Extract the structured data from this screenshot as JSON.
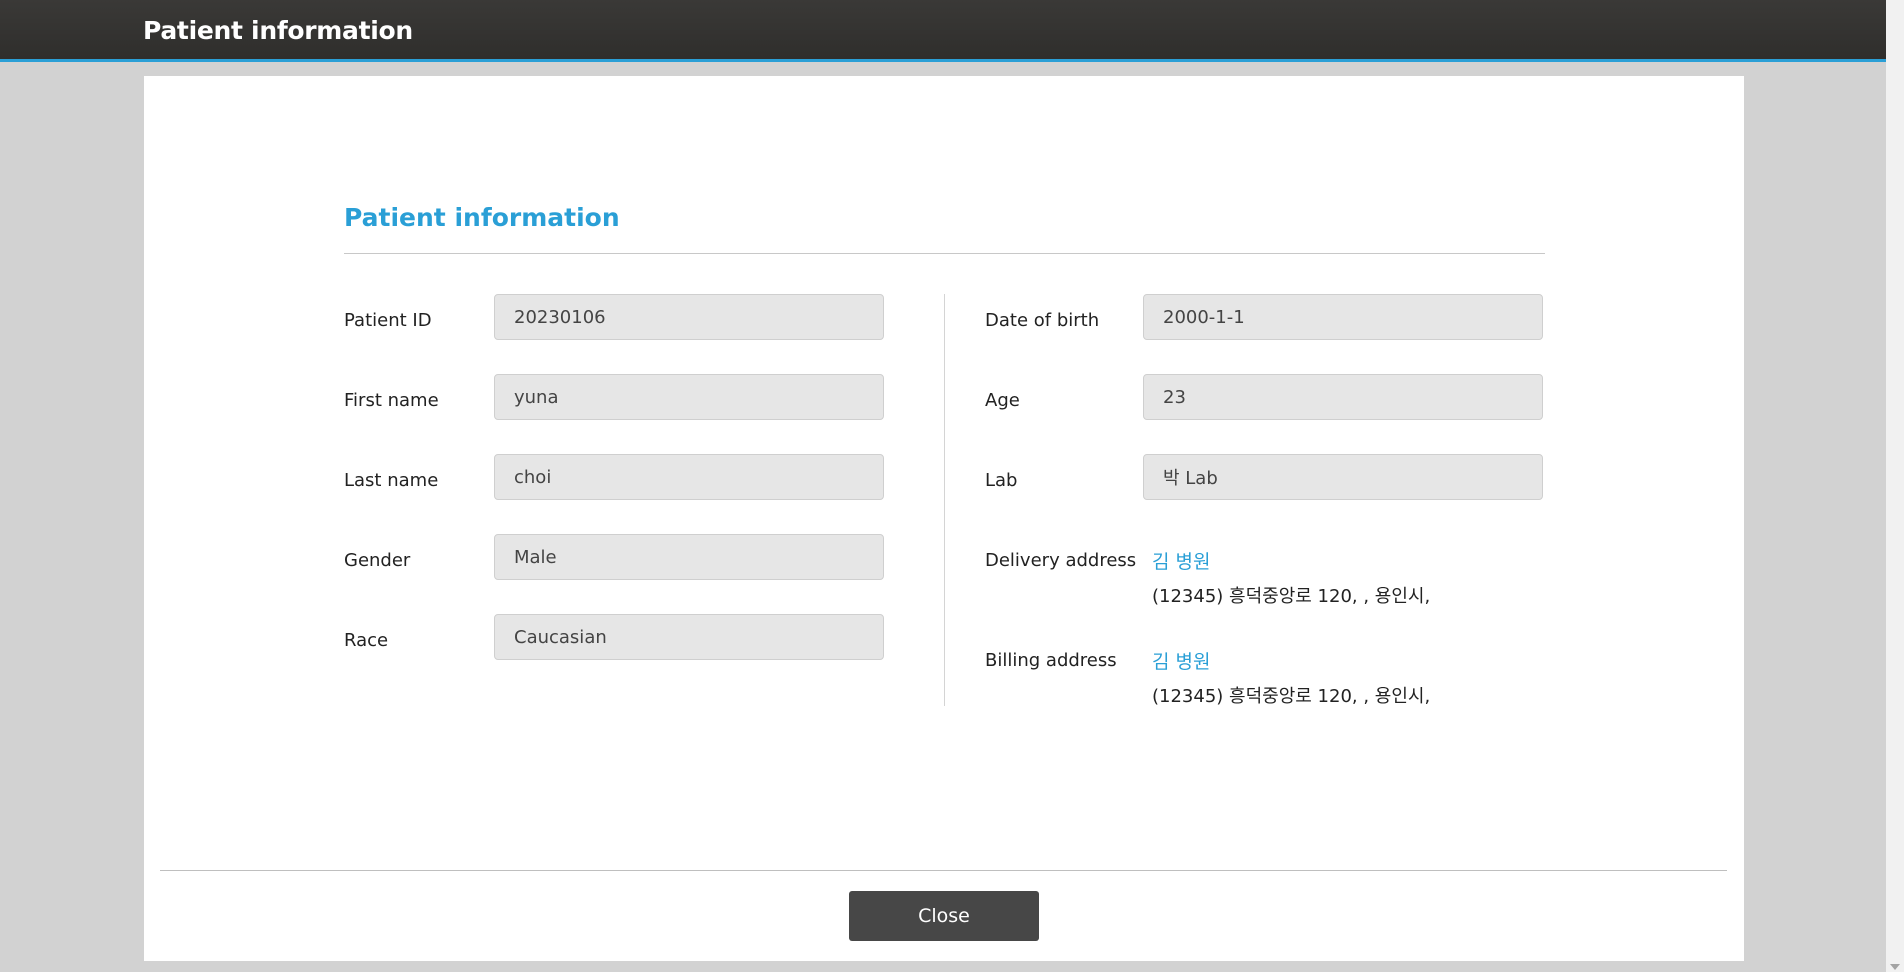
{
  "window": {
    "title": "Patient information"
  },
  "section": {
    "title": "Patient information"
  },
  "left_fields": [
    {
      "label": "Patient ID",
      "value": "20230106"
    },
    {
      "label": "First name",
      "value": "yuna"
    },
    {
      "label": "Last name",
      "value": "choi"
    },
    {
      "label": "Gender",
      "value": "Male"
    },
    {
      "label": "Race",
      "value": "Caucasian"
    }
  ],
  "right_fields": [
    {
      "label": "Date of birth",
      "value": "2000-1-1"
    },
    {
      "label": "Age",
      "value": "23"
    },
    {
      "label": "Lab",
      "value": "박 Lab"
    }
  ],
  "delivery_address": {
    "label": "Delivery address",
    "name": "김 병원",
    "line": "(12345) 흥덕중앙로 120, , 용인시,"
  },
  "billing_address": {
    "label": "Billing address",
    "name": "김 병원",
    "line": "(12345) 흥덕중앙로 120, , 용인시,"
  },
  "footer": {
    "close_label": "Close"
  },
  "colors": {
    "accent": "#2a9fd6",
    "titlebar": "#2f2e2c",
    "button": "#474747"
  }
}
